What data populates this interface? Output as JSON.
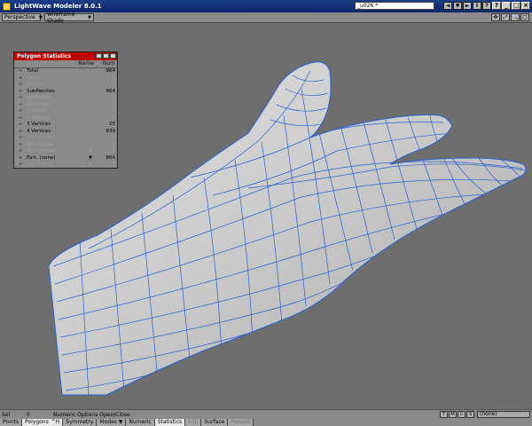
{
  "window": {
    "title": "LightWave Modeler 8.0.1",
    "object_name": "_u026.*",
    "buttons": [
      "?",
      "_",
      "□",
      "×"
    ],
    "tool_buttons": [
      "◄",
      "▼",
      "►",
      "I",
      "?"
    ]
  },
  "viewbar": {
    "view_type": "Perspective",
    "render_mode": "Wireframe Shade",
    "icons": [
      "✥",
      "⤢",
      "🔍",
      "□"
    ]
  },
  "stats_panel": {
    "title": "Polygon Statistics",
    "col_name": "Name",
    "col_num": "Num",
    "rows": [
      {
        "label": "Total",
        "num": "864",
        "dim": false
      },
      {
        "label": "Faces",
        "num": "0",
        "dim": true
      },
      {
        "label": "Curves",
        "num": "0",
        "dim": true
      },
      {
        "label": "SubPatches",
        "num": "864",
        "dim": false
      },
      {
        "label": "Skelegons",
        "num": "0",
        "dim": true
      },
      {
        "label": "Metaballs",
        "num": "0",
        "dim": true
      },
      {
        "label": "1 Vertex",
        "num": "0",
        "dim": true
      },
      {
        "label": "2 Vertices",
        "num": "0",
        "dim": true
      },
      {
        "label": "3 Vertices",
        "num": "25",
        "dim": false
      },
      {
        "label": "4 Vertices",
        "num": "839",
        "dim": false
      },
      {
        "label": ">4 Vertices",
        "num": "0",
        "dim": true
      },
      {
        "label": "Non-planar",
        "num": "0",
        "dim": true
      },
      {
        "label": "Surf. (none)",
        "num": "0",
        "dim": true,
        "dropdown": true
      },
      {
        "label": "Part. (none)",
        "num": "864",
        "dim": false,
        "dropdown": true
      },
      {
        "label": "Col. (none)",
        "num": "0",
        "dim": true,
        "dropdown": true
      }
    ]
  },
  "status": {
    "sel_label": "Sel",
    "sel_count": "0",
    "message": "Numeric Options Open/Close",
    "mode_buttons": [
      "T",
      "M",
      "C",
      "S"
    ],
    "layer": "(none)"
  },
  "tabs": [
    {
      "label": "Points",
      "active": false
    },
    {
      "label": "Polygons",
      "active": true,
      "suffix": "^H"
    },
    {
      "label": "Symmetry",
      "active": false
    },
    {
      "label": "Modes",
      "active": false,
      "dropdown": true
    },
    {
      "label": "Numeric",
      "active": false
    },
    {
      "label": "Statistics",
      "active": true
    },
    {
      "label": "Info",
      "active": false,
      "dim": true
    },
    {
      "label": "Surface",
      "active": false
    },
    {
      "label": "Presets",
      "active": false,
      "dim": true
    }
  ],
  "colors": {
    "titlebar": "#0a246a",
    "panel_title": "#c00000",
    "wire": "#2a5fd0",
    "viewport": "#6e6e6e"
  }
}
